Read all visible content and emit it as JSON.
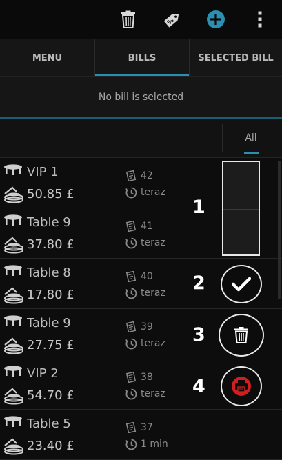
{
  "toolbar": {
    "icons": [
      "trash-icon",
      "tag-percent-icon",
      "add-circle-icon",
      "more-vert-icon"
    ],
    "accent": "#2a8fb3"
  },
  "tabs": [
    {
      "label": "MENU",
      "active": false
    },
    {
      "label": "BILLS",
      "active": true
    },
    {
      "label": "SELECTED BILL",
      "active": false
    }
  ],
  "status": {
    "text": "No bill is selected"
  },
  "filter": {
    "label": "All"
  },
  "bills": [
    {
      "name": "VIP 1",
      "amount": "50.85 £",
      "number": "42",
      "time": "teraz"
    },
    {
      "name": "Table 9",
      "amount": "37.80 £",
      "number": "41",
      "time": "teraz"
    },
    {
      "name": "Table 8",
      "amount": "17.80 £",
      "number": "40",
      "time": "teraz"
    },
    {
      "name": "Table 9",
      "amount": "27.75 £",
      "number": "39",
      "time": "teraz"
    },
    {
      "name": "VIP 2",
      "amount": "54.70 £",
      "number": "38",
      "time": "teraz"
    },
    {
      "name": "Table 5",
      "amount": "23.40 £",
      "number": "37",
      "time": "1 min"
    }
  ],
  "callouts": [
    "1",
    "2",
    "3",
    "4"
  ],
  "colors": {
    "print_red": "#d11f1f"
  }
}
